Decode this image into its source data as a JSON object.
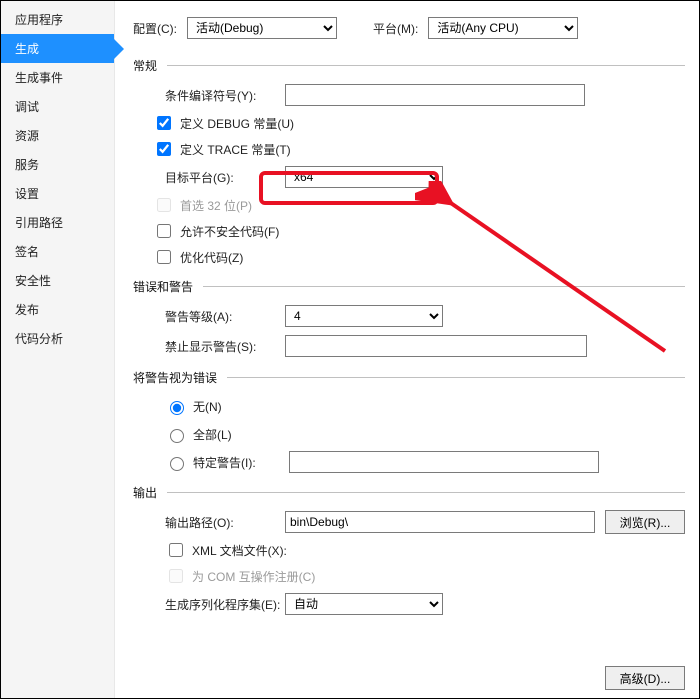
{
  "sidebar": {
    "items": [
      {
        "label": "应用程序"
      },
      {
        "label": "生成"
      },
      {
        "label": "生成事件"
      },
      {
        "label": "调试"
      },
      {
        "label": "资源"
      },
      {
        "label": "服务"
      },
      {
        "label": "设置"
      },
      {
        "label": "引用路径"
      },
      {
        "label": "签名"
      },
      {
        "label": "安全性"
      },
      {
        "label": "发布"
      },
      {
        "label": "代码分析"
      }
    ],
    "selected_index": 1
  },
  "top": {
    "config_label": "配置(C):",
    "config_value": "活动(Debug)",
    "platform_label": "平台(M):",
    "platform_value": "活动(Any CPU)"
  },
  "sections": {
    "general": "常规",
    "errors": "错误和警告",
    "treat": "将警告视为错误",
    "output": "输出"
  },
  "general": {
    "cond_symbols_label": "条件编译符号(Y):",
    "cond_symbols_value": "",
    "define_debug": "定义 DEBUG 常量(U)",
    "define_trace": "定义 TRACE 常量(T)",
    "target_platform_label": "目标平台(G):",
    "target_platform_value": "x64",
    "prefer32": "首选 32 位(P)",
    "unsafe": "允许不安全代码(F)",
    "optimize": "优化代码(Z)"
  },
  "errors": {
    "warn_level_label": "警告等级(A):",
    "warn_level_value": "4",
    "suppress_label": "禁止显示警告(S):",
    "suppress_value": ""
  },
  "treat": {
    "none": "无(N)",
    "all": "全部(L)",
    "specific": "特定警告(I):",
    "specific_value": ""
  },
  "output": {
    "outpath_label": "输出路径(O):",
    "outpath_value": "bin\\Debug\\",
    "browse": "浏览(R)...",
    "xml_doc": "XML 文档文件(X):",
    "com_interop": "为 COM 互操作注册(C)",
    "serial_label": "生成序列化程序集(E):",
    "serial_value": "自动",
    "advanced": "高级(D)..."
  },
  "highlight_color": "#e81123"
}
